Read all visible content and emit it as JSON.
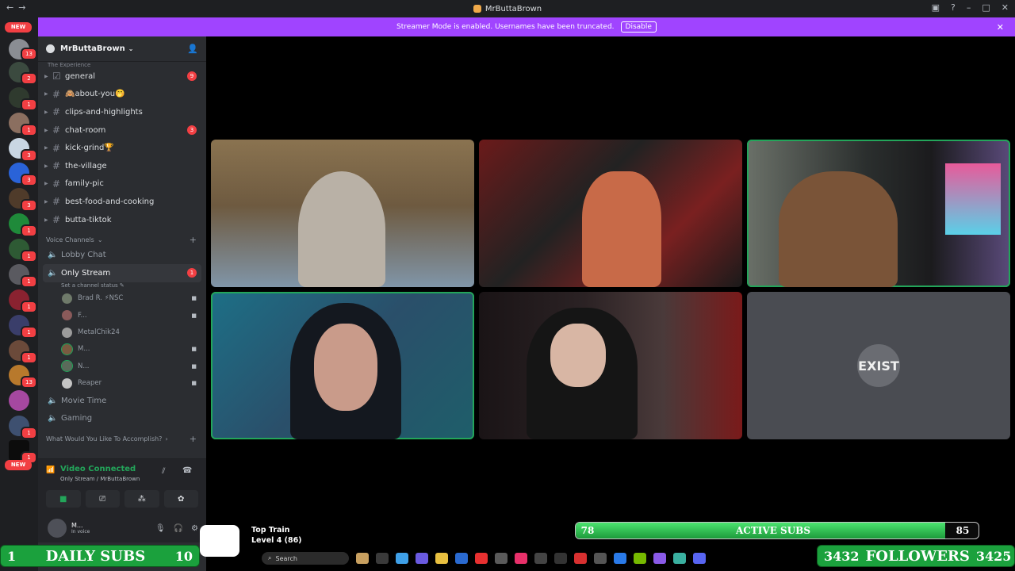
{
  "window": {
    "title": "MrButtaBrown"
  },
  "banner": {
    "text": "Streamer Mode is enabled. Usernames have been truncated.",
    "disable_label": "Disable"
  },
  "rail": {
    "new_label": "NEW",
    "badges": [
      "13",
      "2",
      "1",
      "1",
      "3",
      "3",
      "3",
      "1",
      "1",
      "1",
      "1",
      "1",
      "1",
      "1",
      "13",
      "1",
      "1",
      "1"
    ]
  },
  "server": {
    "name": "MrButtaBrown",
    "truncated_category": "The Experience"
  },
  "text_channels": [
    {
      "name": "general",
      "mention": "9"
    },
    {
      "name": "🙈about-you🤭",
      "mention": ""
    },
    {
      "name": "clips-and-highlights",
      "mention": ""
    },
    {
      "name": "chat-room",
      "mention": "3"
    },
    {
      "name": "kick-grind🏆",
      "mention": ""
    },
    {
      "name": "the-village",
      "mention": ""
    },
    {
      "name": "family-pic",
      "mention": ""
    },
    {
      "name": "best-food-and-cooking",
      "mention": ""
    },
    {
      "name": "butta-tiktok",
      "mention": ""
    }
  ],
  "voice_category": "Voice Channels",
  "voice_channels": {
    "lobby": "Lobby Chat",
    "active": {
      "name": "Only Stream",
      "status": "Set a channel status",
      "mention": "1"
    },
    "users": [
      "Brad R. ⚡NSC",
      "F...",
      "MetalChik24",
      "M...",
      "N...",
      "Reaper"
    ],
    "movie": "Movie Time",
    "gaming": "Gaming"
  },
  "category_2": "What Would You Like To Accomplish?",
  "voice_panel": {
    "title": "Video Connected",
    "sub": "Only Stream / MrButtaBrown"
  },
  "user_panel": {
    "name": "M...",
    "status": "In voice"
  },
  "tiles": {
    "exist_logo": "EXIST"
  },
  "overlay": {
    "top_train": "Top Train",
    "level": "Level 4  (86)",
    "daily_subs": {
      "left": "1",
      "label": "DAILY SUBS",
      "right": "10"
    },
    "active_subs": {
      "left": "78",
      "label": "ACTIVE SUBS",
      "right": "85",
      "progress": 0.917
    },
    "followers": {
      "left": "3432",
      "label": "FOLLOWERS",
      "right": "3425"
    },
    "search": "Search"
  },
  "colors": {
    "banner": "#a044ff",
    "speaking": "#23a55a",
    "mention": "#f23f43",
    "subs_green": "#1ba13d"
  }
}
